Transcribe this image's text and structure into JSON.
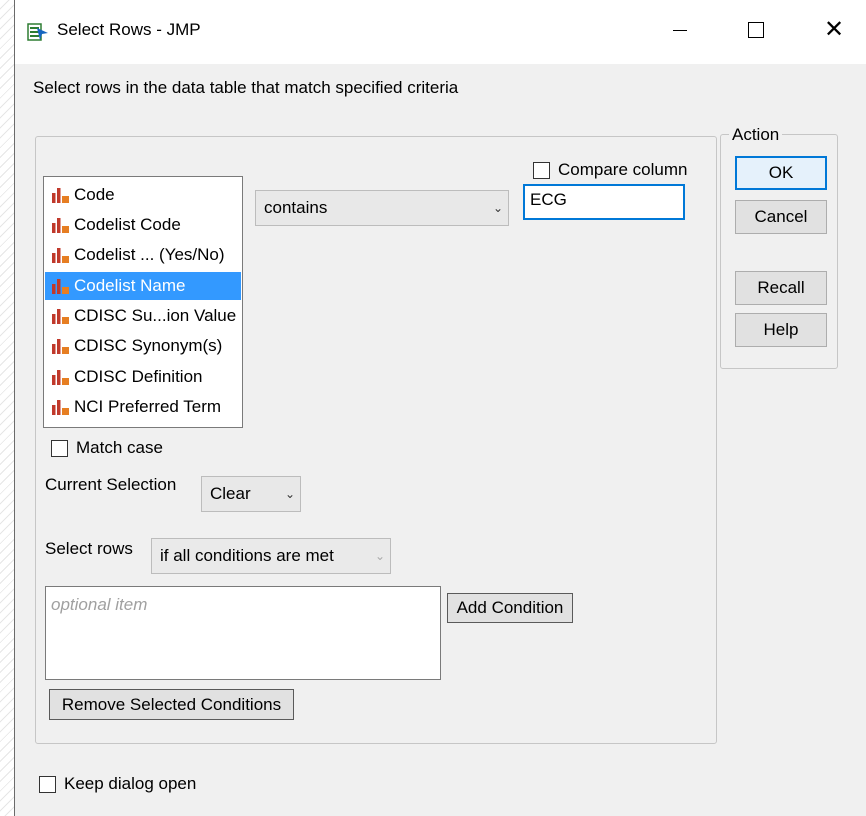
{
  "window": {
    "title": "Select Rows - JMP"
  },
  "description": "Select rows in the data table that match specified criteria",
  "compare_column": {
    "label": "Compare column",
    "checked": false
  },
  "columns": [
    {
      "label": "Code",
      "selected": false
    },
    {
      "label": "Codelist Code",
      "selected": false
    },
    {
      "label": "Codelist ... (Yes/No)",
      "selected": false
    },
    {
      "label": "Codelist Name",
      "selected": true
    },
    {
      "label": "CDISC Su...ion Value",
      "selected": false
    },
    {
      "label": "CDISC Synonym(s)",
      "selected": false
    },
    {
      "label": "CDISC Definition",
      "selected": false
    },
    {
      "label": "NCI Preferred Term",
      "selected": false
    }
  ],
  "operator": {
    "value": "contains"
  },
  "match_value": "ECG",
  "match_case": {
    "label": "Match case",
    "checked": false
  },
  "current_selection": {
    "label": "Current Selection",
    "value": "Clear"
  },
  "select_rows": {
    "label": "Select rows",
    "value": "if all conditions are met"
  },
  "conditions": {
    "placeholder": "optional item"
  },
  "buttons": {
    "add_condition": "Add Condition",
    "remove_selected": "Remove Selected Conditions",
    "ok": "OK",
    "cancel": "Cancel",
    "recall": "Recall",
    "help": "Help"
  },
  "action_group": {
    "label": "Action"
  },
  "keep_open": {
    "label": "Keep dialog open",
    "checked": false
  },
  "colors": {
    "selection": "#3399ff",
    "focus": "#0078d7",
    "column_icon": "#c0392b"
  },
  "icons": {
    "app": "jmp-select-rows-icon",
    "column": "continuous-column-icon"
  }
}
